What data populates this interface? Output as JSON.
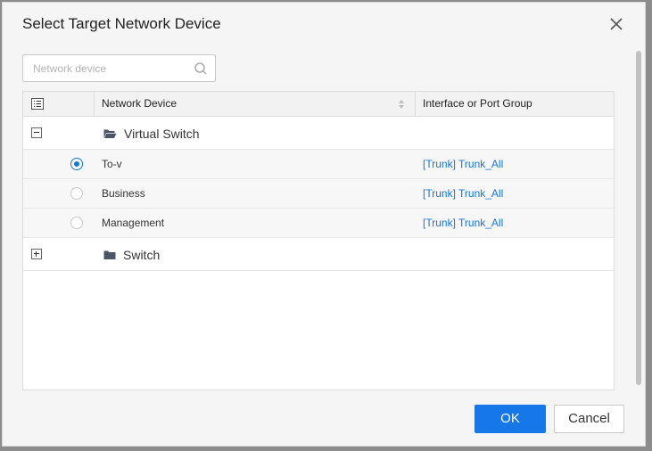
{
  "dialog": {
    "title": "Select Target Network Device",
    "search_placeholder": "Network device",
    "ok_label": "OK",
    "cancel_label": "Cancel"
  },
  "table": {
    "headers": {
      "network_device": "Network Device",
      "interface": "Interface or Port Group"
    },
    "groups": [
      {
        "label": "Virtual Switch",
        "expanded": true,
        "rows": [
          {
            "device": "To-v",
            "interface": "[Trunk] Trunk_All",
            "selected": true
          },
          {
            "device": "Business",
            "interface": "[Trunk] Trunk_All",
            "selected": false
          },
          {
            "device": "Management",
            "interface": "[Trunk] Trunk_All",
            "selected": false
          }
        ]
      },
      {
        "label": "Switch",
        "expanded": false,
        "rows": []
      }
    ]
  },
  "colors": {
    "accent": "#1677e8",
    "link": "#1677d6"
  }
}
